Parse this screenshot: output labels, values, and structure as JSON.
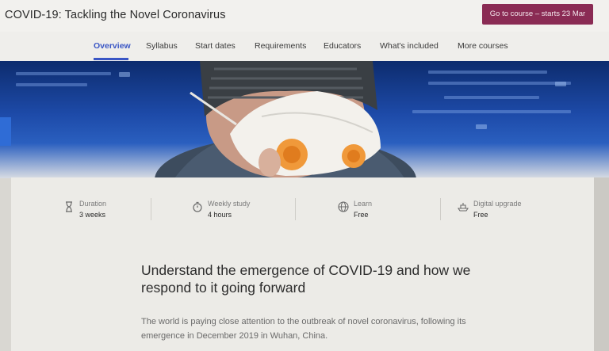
{
  "header": {
    "course_title": "COVID-19: Tackling the Novel Coronavirus",
    "cta_label": "Go to course – starts 23 Mar"
  },
  "nav": {
    "items": [
      {
        "label": "Overview",
        "active": true
      },
      {
        "label": "Syllabus"
      },
      {
        "label": "Start dates"
      },
      {
        "label": "Requirements"
      },
      {
        "label": "Educators"
      },
      {
        "label": "What's included"
      },
      {
        "label": "More courses"
      }
    ]
  },
  "info": {
    "duration": {
      "icon": "hourglass-icon",
      "label": "Duration",
      "value": "3 weeks"
    },
    "weekly_study": {
      "icon": "stopwatch-icon",
      "label": "Weekly study",
      "value": "4 hours"
    },
    "learn": {
      "icon": "globe-icon",
      "label": "Learn",
      "value": "Free"
    },
    "digital_upgrade": {
      "icon": "ship-icon",
      "label": "Digital upgrade",
      "value": "Free"
    }
  },
  "main": {
    "headline": "Understand the emergence of COVID-19 and how we respond to it going forward",
    "lede": "The world is paying close attention to the outbreak of novel coronavirus, following its emergence in December 2019 in Wuhan, China."
  },
  "colors": {
    "accent": "#3a56c5",
    "cta_bg": "#8a2b54"
  }
}
